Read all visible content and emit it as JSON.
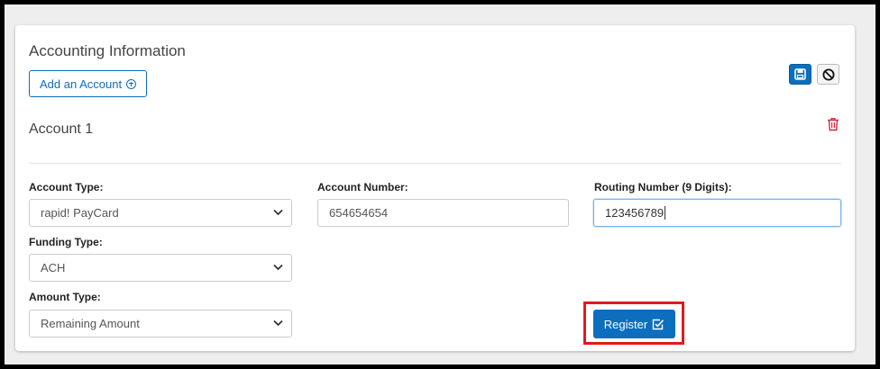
{
  "section": {
    "title": "Accounting Information",
    "add_account_label": "Add an Account"
  },
  "toolbar": {
    "save_icon": "save-icon",
    "cancel_icon": "cancel-icon"
  },
  "account": {
    "title": "Account 1",
    "delete_icon": "trash-icon",
    "fields": {
      "account_type": {
        "label": "Account Type:",
        "value": "rapid! PayCard"
      },
      "account_number": {
        "label": "Account Number:",
        "value": "654654654"
      },
      "routing_number": {
        "label": "Routing Number (9 Digits):",
        "value": "123456789"
      },
      "funding_type": {
        "label": "Funding Type:",
        "value": "ACH"
      },
      "amount_type": {
        "label": "Amount Type:",
        "value": "Remaining Amount"
      }
    },
    "register_label": "Register"
  },
  "colors": {
    "primary": "#0c6ebd",
    "danger": "#d9263a",
    "highlight": "#e21a1a"
  }
}
